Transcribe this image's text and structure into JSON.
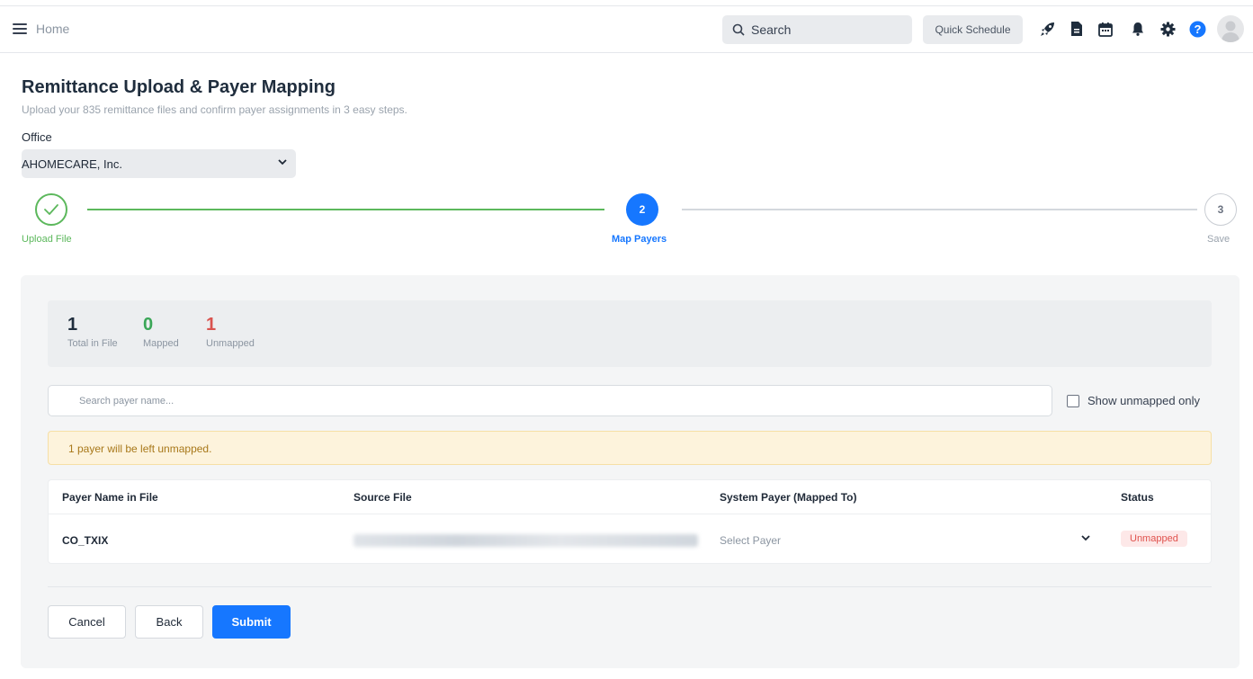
{
  "topbar": {
    "home_label": "Home",
    "search_label": "Search",
    "quick_schedule_label": "Quick Schedule",
    "icons": [
      "menu-icon",
      "search-icon",
      "rocket-icon",
      "document-icon",
      "calendar-icon",
      "bell-icon",
      "gear-icon",
      "help-icon",
      "user-avatar"
    ],
    "help_glyph": "?"
  },
  "header": {
    "title": "Remittance Upload & Payer Mapping",
    "subtitle": "Upload your 835 remittance files and confirm payer assignments in 3 easy steps.",
    "office_label": "Office",
    "office_value": "AHOMECARE, Inc."
  },
  "stepper": {
    "steps": [
      {
        "number": "1",
        "label": "Upload File",
        "state": "completed"
      },
      {
        "number": "2",
        "label": "Map Payers",
        "state": "active"
      },
      {
        "number": "3",
        "label": "Save",
        "state": "pending"
      }
    ]
  },
  "stats": [
    {
      "value": "1",
      "caption": "Total in File"
    },
    {
      "value": "0",
      "caption": "Mapped"
    },
    {
      "value": "1",
      "caption": "Unmapped"
    }
  ],
  "filters": {
    "search_placeholder": "Search payer name...",
    "unmapped_only_label": "Show unmapped only",
    "unmapped_only_checked": false
  },
  "warning": {
    "text": "1 payer will be left unmapped."
  },
  "table": {
    "columns": [
      "Payer Name in File",
      "Source File",
      "System Payer (Mapped To)",
      "Status"
    ],
    "rows": [
      {
        "payer_name": "CO_TXIX",
        "system_payer_placeholder": "Select Payer",
        "status": "Unmapped"
      }
    ]
  },
  "actions": {
    "cancel_label": "Cancel",
    "back_label": "Back",
    "submit_label": "Submit"
  },
  "colors": {
    "primary": "#1677ff",
    "success": "#5cb85c",
    "danger": "#e0524d",
    "warning_bg": "#fdf3dc"
  }
}
